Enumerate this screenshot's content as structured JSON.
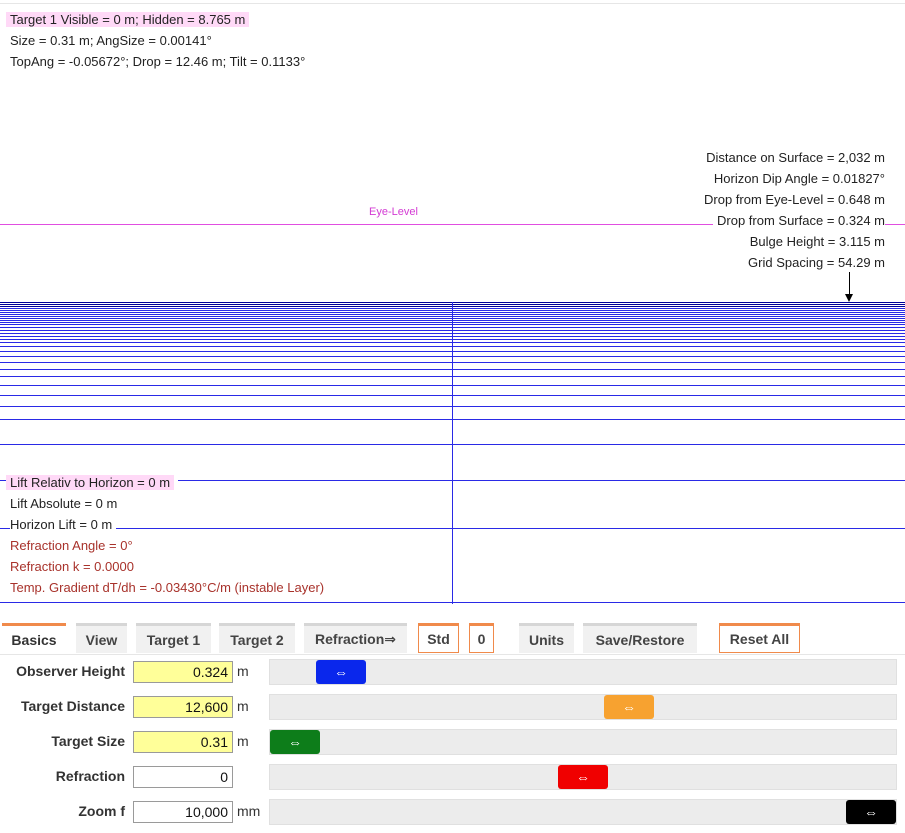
{
  "target_info": {
    "visible_line": "Target 1 Visible = 0 m; Hidden = 8.765 m",
    "size_line": "Size  = 0.31 m; AngSize = 0.00141°",
    "topang_line": "TopAng = -0.05672°; Drop = 12.46 m; Tilt = 0.1133°"
  },
  "eye_level_label": "Eye-Level",
  "right_info": {
    "distance": "Distance on Surface = 2,032 m",
    "dip": "Horizon Dip Angle = 0.01827°",
    "drop_eye": "Drop from Eye-Level = 0.648 m",
    "drop_surface": "Drop from Surface = 0.324 m",
    "bulge": "Bulge Height = 3.115 m",
    "grid_spacing": "Grid Spacing = 54.29 m"
  },
  "lift_info": {
    "lift_relative": "Lift Relativ to Horizon = 0 m",
    "lift_absolute": "Lift Absolute = 0 m",
    "horizon_lift": "Horizon Lift = 0 m",
    "refraction_angle": "Refraction Angle = 0°",
    "refraction_k": "Refraction k = 0.0000",
    "temp_gradient": "Temp. Gradient dT/dh = -0.03430°C/m (instable Layer)"
  },
  "tabs": {
    "basics": "Basics",
    "view": "View",
    "target1": "Target 1",
    "target2": "Target 2",
    "refraction": "Refraction⇒",
    "std": "Std",
    "zero": "0",
    "units": "Units",
    "save_restore": "Save/Restore",
    "reset_all": "Reset All"
  },
  "controls": {
    "observer_height": {
      "label": "Observer Height",
      "value": "0.324",
      "unit": "m",
      "slider_fraction": 0.08,
      "knob_color": "#0a27ec"
    },
    "target_distance": {
      "label": "Target Distance",
      "value": "12,600",
      "unit": "m",
      "slider_fraction": 0.58,
      "knob_color": "#f7a230"
    },
    "target_size": {
      "label": "Target Size",
      "value": "0.31",
      "unit": "m",
      "slider_fraction": 0.0,
      "knob_color": "#0d7d1a"
    },
    "refraction": {
      "label": "Refraction",
      "value": "0",
      "unit": "",
      "slider_fraction": 0.5,
      "knob_color": "#f00000"
    },
    "zoom": {
      "label": "Zoom f",
      "value": "10,000",
      "unit": "mm",
      "slider_fraction": 1.0,
      "knob_color": "#000000"
    }
  },
  "knob_symbol": "⇔",
  "colors": {
    "grid": "#2a2ae6",
    "eye_level": "#e04ee0",
    "highlight": "#ffd9f7",
    "refraction_text": "#a8322b",
    "tab_accent": "#f08a4b",
    "field_yellow": "#ffff99"
  }
}
